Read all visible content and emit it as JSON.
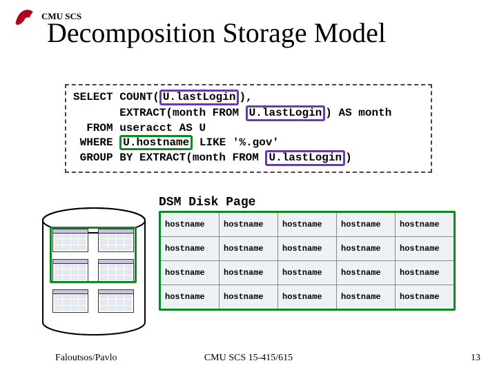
{
  "header": {
    "org": "CMU SCS"
  },
  "title": "Decomposition Storage Model",
  "sql": {
    "kw_select": "SELECT",
    "count_open": "COUNT(",
    "count_arg": "U.lastLogin",
    "count_close": "),",
    "extract1_open": "EXTRACT(month FROM",
    "extract1_arg": "U.lastLogin",
    "extract1_close": ") AS month",
    "kw_from": "FROM",
    "from_rest": "useracct AS U",
    "kw_where": "WHERE",
    "where_col": "U.hostname",
    "where_rest": "LIKE '%.gov'",
    "kw_group": "GROUP",
    "group_rest_open": "BY EXTRACT(month FROM",
    "group_arg": "U.lastLogin",
    "group_rest_close": ")"
  },
  "dsm": {
    "title": "DSM Disk Page",
    "cell": "hostname",
    "rows": 4,
    "cols": 5
  },
  "footer": {
    "left": "Faloutsos/Pavlo",
    "center": "CMU SCS 15-415/615",
    "right": "13"
  }
}
